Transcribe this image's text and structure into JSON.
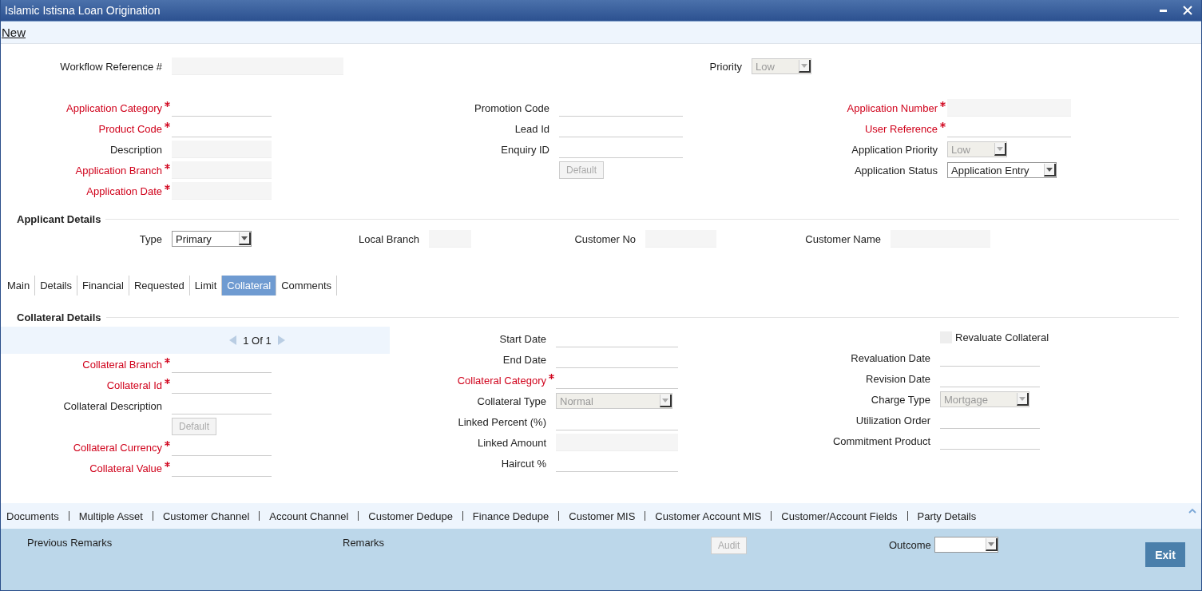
{
  "window": {
    "title": "Islamic Istisna Loan Origination"
  },
  "toolbar": {
    "action": "New"
  },
  "header": {
    "columns": [
      [
        {
          "kind": "text",
          "label": "Workflow Reference #",
          "required": false,
          "disabled": true
        }
      ],
      [
        {
          "kind": "select",
          "label": "Priority",
          "value": "Low",
          "disabled": true
        }
      ]
    ]
  },
  "application": {
    "columns": [
      [
        {
          "kind": "text",
          "label": "Application Category",
          "required": true,
          "disabled": false
        },
        {
          "kind": "text",
          "label": "Product Code",
          "required": true,
          "disabled": false
        },
        {
          "kind": "text",
          "label": "Description",
          "required": false,
          "disabled": true
        },
        {
          "kind": "text",
          "label": "Application Branch",
          "required": true,
          "disabled": true
        },
        {
          "kind": "text",
          "label": "Application Date",
          "required": true,
          "disabled": true
        }
      ],
      [
        {
          "kind": "text",
          "label": "Promotion Code",
          "required": false,
          "disabled": false
        },
        {
          "kind": "text",
          "label": "Lead Id",
          "required": false,
          "disabled": false
        },
        {
          "kind": "text",
          "label": "Enquiry ID",
          "required": false,
          "disabled": false
        },
        {
          "kind": "button",
          "text": "Default",
          "disabled": true
        }
      ],
      [
        {
          "kind": "text",
          "label": "Application Number",
          "required": true,
          "disabled": true
        },
        {
          "kind": "text",
          "label": "User Reference",
          "required": true,
          "disabled": false
        },
        {
          "kind": "select",
          "label": "Application Priority",
          "value": "Low",
          "disabled": true
        },
        {
          "kind": "select",
          "label": "Application Status",
          "value": "Application Entry",
          "disabled": false
        }
      ]
    ]
  },
  "applicant_details": {
    "title": "Applicant Details",
    "columns": [
      [
        {
          "kind": "select",
          "label": "Type",
          "value": "Primary",
          "disabled": false
        }
      ],
      [
        {
          "kind": "text",
          "label": "Local Branch",
          "required": false,
          "disabled": true
        }
      ],
      [
        {
          "kind": "text",
          "label": "Customer No",
          "required": false,
          "disabled": true
        }
      ],
      [
        {
          "kind": "text",
          "label": "Customer Name",
          "required": false,
          "disabled": true
        }
      ]
    ]
  },
  "tabs": [
    {
      "label": "Main",
      "selected": false
    },
    {
      "label": "Details",
      "selected": false
    },
    {
      "label": "Financial",
      "selected": false
    },
    {
      "label": "Requested",
      "selected": false
    },
    {
      "label": "Limit",
      "selected": false
    },
    {
      "label": "Collateral",
      "selected": true
    },
    {
      "label": "Comments",
      "selected": false
    }
  ],
  "collateral_details": {
    "title": "Collateral Details",
    "columns": [
      [
        {
          "kind": "pager",
          "text": "1 Of 1"
        },
        {
          "kind": "text",
          "label": "Collateral Branch",
          "required": true,
          "disabled": false
        },
        {
          "kind": "text",
          "label": "Collateral Id",
          "required": true,
          "disabled": false
        },
        {
          "kind": "text",
          "label": "Collateral Description",
          "required": false,
          "disabled": false
        },
        {
          "kind": "button",
          "text": "Default",
          "disabled": true
        },
        {
          "kind": "text",
          "label": "Collateral Currency",
          "required": true,
          "disabled": false
        },
        {
          "kind": "text",
          "label": "Collateral Value",
          "required": true,
          "disabled": false
        }
      ],
      [
        {
          "kind": "text",
          "label": "Start Date",
          "required": false,
          "disabled": false
        },
        {
          "kind": "text",
          "label": "End Date",
          "required": false,
          "disabled": false
        },
        {
          "kind": "text",
          "label": "Collateral Category",
          "required": true,
          "disabled": false
        },
        {
          "kind": "select",
          "label": "Collateral Type",
          "value": "Normal",
          "disabled": true
        },
        {
          "kind": "text",
          "label": "Linked Percent (%)",
          "required": false,
          "disabled": false
        },
        {
          "kind": "text",
          "label": "Linked Amount",
          "required": false,
          "disabled": true
        },
        {
          "kind": "text",
          "label": "Haircut %",
          "required": false,
          "disabled": false
        }
      ],
      [
        {
          "kind": "checkbox",
          "text": "Revaluate Collateral",
          "checked": false
        },
        {
          "kind": "text",
          "label": "Revaluation Date",
          "required": false,
          "disabled": false
        },
        {
          "kind": "text",
          "label": "Revision Date",
          "required": false,
          "disabled": false
        },
        {
          "kind": "select",
          "label": "Charge Type",
          "value": "Mortgage",
          "disabled": true
        },
        {
          "kind": "text",
          "label": "Utilization Order",
          "required": false,
          "disabled": false
        },
        {
          "kind": "text",
          "label": "Commitment Product",
          "required": false,
          "disabled": false
        }
      ]
    ]
  },
  "links": [
    "Documents",
    "Multiple Asset",
    "Customer Channel",
    "Account Channel",
    "Customer Dedupe",
    "Finance Dedupe",
    "Customer MIS",
    "Customer Account MIS",
    "Customer/Account Fields",
    "Party Details"
  ],
  "footer": {
    "previous_remarks": "Previous Remarks",
    "remarks": "Remarks",
    "audit": {
      "label": "Audit",
      "disabled": true
    },
    "outcome": {
      "label": "Outcome"
    },
    "exit": "Exit"
  }
}
